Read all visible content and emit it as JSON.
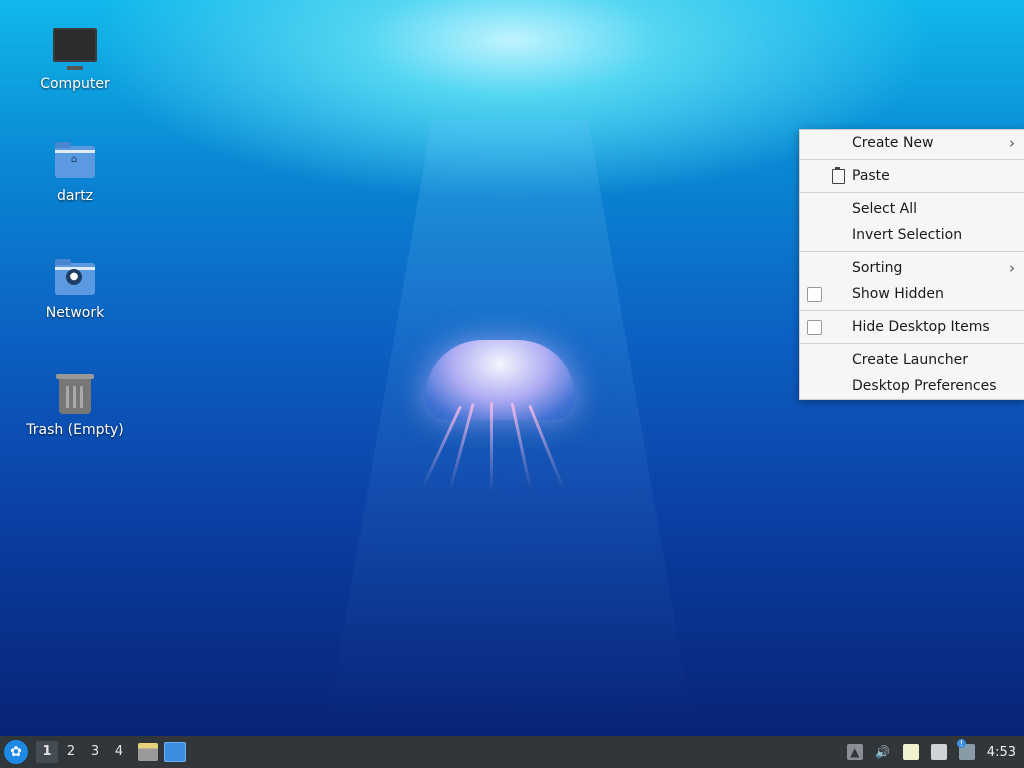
{
  "desktop": {
    "icons": [
      {
        "label": "Computer",
        "icon": "computer-icon"
      },
      {
        "label": "dartz",
        "icon": "home-folder-icon"
      },
      {
        "label": "Network",
        "icon": "network-folder-icon"
      },
      {
        "label": "Trash (Empty)",
        "icon": "trash-icon"
      }
    ]
  },
  "context_menu": {
    "create_new": "Create New",
    "paste": "Paste",
    "select_all": "Select All",
    "invert_selection": "Invert Selection",
    "sorting": "Sorting",
    "show_hidden": "Show Hidden",
    "hide_desktop_items": "Hide Desktop Items",
    "create_launcher": "Create Launcher",
    "desktop_preferences": "Desktop Preferences",
    "show_hidden_checked": false,
    "hide_desktop_items_checked": false
  },
  "panel": {
    "workspaces": [
      "1",
      "2",
      "3",
      "4"
    ],
    "active_workspace": "1",
    "clock": "4:53"
  },
  "colors": {
    "panel_bg": "#31363b",
    "menu_bg": "#f6f6f6",
    "accent": "#1e88e5"
  }
}
